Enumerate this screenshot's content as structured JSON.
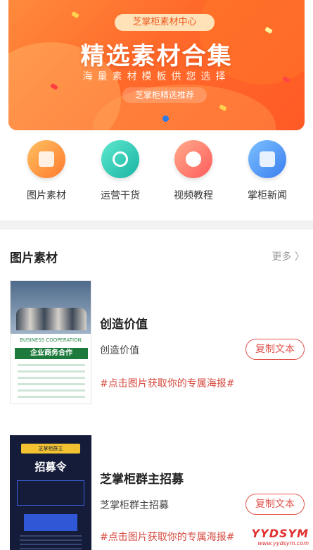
{
  "banner": {
    "tag": "芝掌柜素材中心",
    "title": "精选素材合集",
    "subtitle": "海量素材模板供您选择",
    "badge": "芝掌柜精选推荐"
  },
  "categories": [
    {
      "label": "图片素材",
      "icon": "image-icon",
      "color_from": "#ffb347",
      "color_to": "#ff7a2f"
    },
    {
      "label": "运营干货",
      "icon": "refresh-icon",
      "color_from": "#4fe0c6",
      "color_to": "#1bb8a8"
    },
    {
      "label": "视频教程",
      "icon": "film-reel-icon",
      "color_from": "#ff9a7a",
      "color_to": "#ff5e5e"
    },
    {
      "label": "掌柜新闻",
      "icon": "news-icon",
      "color_from": "#6fb8ff",
      "color_to": "#3a7ef0"
    }
  ],
  "section": {
    "title": "图片素材",
    "more": "更多 〉"
  },
  "cards": [
    {
      "title": "创造价值",
      "subtitle": "创造价值",
      "copy_label": "复制文本",
      "link": "#点击图片获取你的专属海报#",
      "poster": {
        "header": "BUSINESS COOPERATION",
        "banner": "企业商务合作"
      }
    },
    {
      "title": "芝掌柜群主招募",
      "subtitle": "芝掌柜群主招募",
      "copy_label": "复制文本",
      "link": "#点击图片获取你的专属海报#",
      "poster": {
        "tag": "芝掌柜群主",
        "banner": "招募令"
      }
    }
  ],
  "watermark": {
    "line1": "YYDSYM",
    "line2": "www.yydsym.com"
  }
}
